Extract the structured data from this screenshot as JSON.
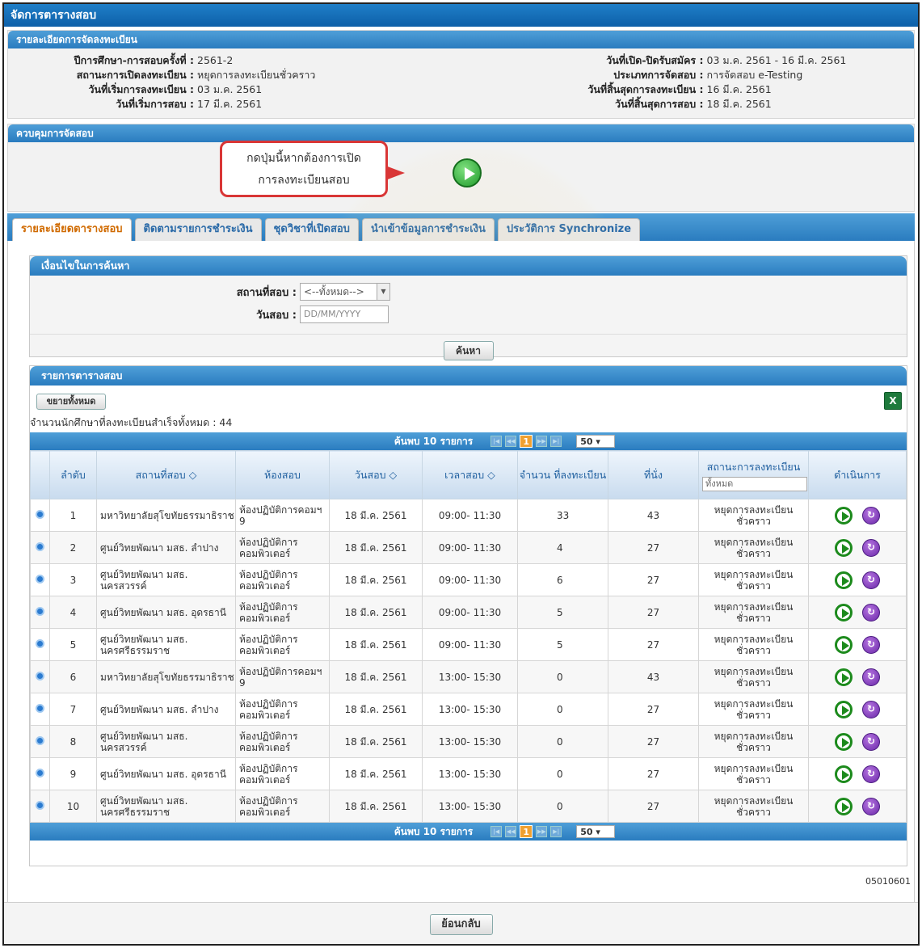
{
  "window": {
    "title": "จัดการตารางสอบ"
  },
  "registration": {
    "header": "รายละเอียดการจัดลงทะเบียน",
    "left": [
      {
        "label": "ปีการศึกษา-การสอบครั้งที่ :",
        "value": "2561-2"
      },
      {
        "label": "สถานะการเปิดลงทะเบียน :",
        "value": "หยุดการลงทะเบียนชั่วคราว"
      },
      {
        "label": "วันที่เริ่มการลงทะเบียน :",
        "value": "03 ม.ค. 2561"
      },
      {
        "label": "วันที่เริ่มการสอบ :",
        "value": "17 มี.ค. 2561"
      }
    ],
    "right": [
      {
        "label": "วันที่เปิด-ปิดรับสมัคร :",
        "value": "03 ม.ค. 2561 - 16 มี.ค. 2561"
      },
      {
        "label": "ประเภทการจัดสอบ :",
        "value": "การจัดสอบ e-Testing"
      },
      {
        "label": "วันที่สิ้นสุดการลงทะเบียน :",
        "value": "16 มี.ค. 2561"
      },
      {
        "label": "วันที่สิ้นสุดการสอบ :",
        "value": "18 มี.ค. 2561"
      }
    ]
  },
  "control": {
    "header": "ควบคุมการจัดสอบ",
    "callout_line1": "กดปุ่มนี้หากต้องการเปิด",
    "callout_line2": "การลงทะเบียนสอบ"
  },
  "tabs": [
    {
      "label": "รายละเอียดตารางสอบ"
    },
    {
      "label": "ติดตามรายการชำระเงิน"
    },
    {
      "label": "ชุดวิชาที่เปิดสอบ"
    },
    {
      "label": "นำเข้าข้อมูลการชำระเงิน"
    },
    {
      "label": "ประวัติการ Synchronize"
    }
  ],
  "search": {
    "header": "เงื่อนไขในการค้นหา",
    "place_label": "สถานที่สอบ :",
    "place_value": "<--ทั้งหมด-->",
    "date_label": "วันสอบ :",
    "date_placeholder": "DD/MM/YYYY",
    "button": "ค้นหา"
  },
  "list": {
    "header": "รายการตารางสอบ",
    "expand_button": "ขยายทั้งหมด",
    "total_text": "จำนวนนักศึกษาที่ลงทะเบียนสำเร็จทั้งหมด : 44",
    "found_text": "ค้นพบ 10 รายการ",
    "current_page": "1",
    "page_size": "50",
    "columns": [
      "ลำดับ",
      "สถานที่สอบ ◇",
      "ห้องสอบ",
      "วันสอบ ◇",
      "เวลาสอบ ◇",
      "จำนวน ที่ลงทะเบียน",
      "ที่นั่ง",
      "สถานะการลงทะเบียน",
      "ดำเนินการ"
    ],
    "status_filter": "ทั้งหมด",
    "rows": [
      {
        "no": "1",
        "place": "มหาวิทยาลัยสุโขทัยธรรมาธิราช",
        "room": "ห้องปฏิบัติการคอมฯ 9",
        "date": "18 มี.ค. 2561",
        "time": "09:00- 11:30",
        "registered": "33",
        "seats": "43",
        "status": "หยุดการลงทะเบียนชั่วคราว"
      },
      {
        "no": "2",
        "place": "ศูนย์วิทยพัฒนา มสธ. ลำปาง",
        "room": "ห้องปฏิบัติการคอมพิวเตอร์",
        "date": "18 มี.ค. 2561",
        "time": "09:00- 11:30",
        "registered": "4",
        "seats": "27",
        "status": "หยุดการลงทะเบียนชั่วคราว"
      },
      {
        "no": "3",
        "place": "ศูนย์วิทยพัฒนา มสธ. นครสวรรค์",
        "room": "ห้องปฏิบัติการคอมพิวเตอร์",
        "date": "18 มี.ค. 2561",
        "time": "09:00- 11:30",
        "registered": "6",
        "seats": "27",
        "status": "หยุดการลงทะเบียนชั่วคราว"
      },
      {
        "no": "4",
        "place": "ศูนย์วิทยพัฒนา มสธ. อุดรธานี",
        "room": "ห้องปฏิบัติการคอมพิวเตอร์",
        "date": "18 มี.ค. 2561",
        "time": "09:00- 11:30",
        "registered": "5",
        "seats": "27",
        "status": "หยุดการลงทะเบียนชั่วคราว"
      },
      {
        "no": "5",
        "place": "ศูนย์วิทยพัฒนา มสธ. นครศรีธรรมราช",
        "room": "ห้องปฏิบัติการคอมพิวเตอร์",
        "date": "18 มี.ค. 2561",
        "time": "09:00- 11:30",
        "registered": "5",
        "seats": "27",
        "status": "หยุดการลงทะเบียนชั่วคราว"
      },
      {
        "no": "6",
        "place": "มหาวิทยาลัยสุโขทัยธรรมาธิราช",
        "room": "ห้องปฏิบัติการคอมฯ 9",
        "date": "18 มี.ค. 2561",
        "time": "13:00- 15:30",
        "registered": "0",
        "seats": "43",
        "status": "หยุดการลงทะเบียนชั่วคราว"
      },
      {
        "no": "7",
        "place": "ศูนย์วิทยพัฒนา มสธ. ลำปาง",
        "room": "ห้องปฏิบัติการคอมพิวเตอร์",
        "date": "18 มี.ค. 2561",
        "time": "13:00- 15:30",
        "registered": "0",
        "seats": "27",
        "status": "หยุดการลงทะเบียนชั่วคราว"
      },
      {
        "no": "8",
        "place": "ศูนย์วิทยพัฒนา มสธ. นครสวรรค์",
        "room": "ห้องปฏิบัติการคอมพิวเตอร์",
        "date": "18 มี.ค. 2561",
        "time": "13:00- 15:30",
        "registered": "0",
        "seats": "27",
        "status": "หยุดการลงทะเบียนชั่วคราว"
      },
      {
        "no": "9",
        "place": "ศูนย์วิทยพัฒนา มสธ. อุดรธานี",
        "room": "ห้องปฏิบัติการคอมพิวเตอร์",
        "date": "18 มี.ค. 2561",
        "time": "13:00- 15:30",
        "registered": "0",
        "seats": "27",
        "status": "หยุดการลงทะเบียนชั่วคราว"
      },
      {
        "no": "10",
        "place": "ศูนย์วิทยพัฒนา มสธ. นครศรีธรรมราช",
        "room": "ห้องปฏิบัติการคอมพิวเตอร์",
        "date": "18 มี.ค. 2561",
        "time": "13:00- 15:30",
        "registered": "0",
        "seats": "27",
        "status": "หยุดการลงทะเบียนชั่วคราว"
      }
    ]
  },
  "page_code": "05010601",
  "back_button": "ย้อนกลับ",
  "icons": {
    "expand": "expand-row-icon",
    "open": "play-icon",
    "manage": "refresh-icon",
    "excel": "excel-icon"
  }
}
